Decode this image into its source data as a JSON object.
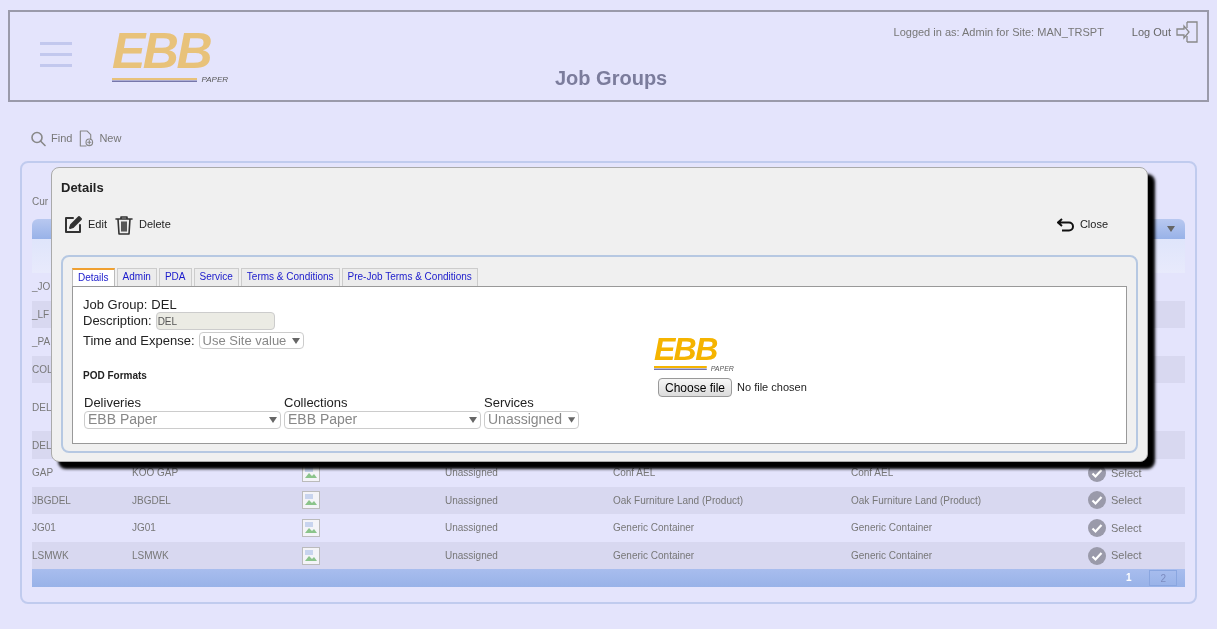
{
  "header": {
    "logo": {
      "name": "EBB",
      "tag": "PAPER"
    },
    "title": "Job Groups",
    "logged_in": "Logged in as: Admin for Site: MAN_TRSPT",
    "logout": "Log Out"
  },
  "toolbar": [
    {
      "kind": "find",
      "label": "Find"
    },
    {
      "kind": "new",
      "label": "New"
    }
  ],
  "list": {
    "label": "Cur",
    "rows": [
      {
        "cells": [
          "_JO"
        ]
      },
      {
        "cells": [
          "_LF"
        ]
      },
      {
        "cells": [
          "_PA"
        ]
      },
      {
        "cells": [
          "COL"
        ]
      },
      {
        "cells": [
          "DEL"
        ],
        "tall": true
      },
      {
        "cells": [
          "DEL"
        ]
      },
      {
        "cells": [
          "GAP",
          "KOO GAP",
          "Unassigned",
          "Conf AEL",
          "Conf AEL"
        ],
        "action": "Select"
      },
      {
        "cells": [
          "JBGDEL",
          "JBGDEL",
          "Unassigned",
          "Oak Furniture Land (Product)",
          "Oak Furniture Land (Product)"
        ],
        "action": "Select"
      },
      {
        "cells": [
          "JG01",
          "JG01",
          "Unassigned",
          "Generic Container",
          "Generic Container"
        ],
        "action": "Select"
      },
      {
        "cells": [
          "LSMWK",
          "LSMWK",
          "Unassigned",
          "Generic Container",
          "Generic Container"
        ],
        "action": "Select"
      }
    ],
    "pager": [
      {
        "label": "1",
        "selected": true
      },
      {
        "label": "2",
        "selected": false
      }
    ]
  },
  "modal": {
    "title": "Details",
    "actions": [
      {
        "kind": "edit",
        "label": "Edit"
      },
      {
        "kind": "delete",
        "label": "Delete"
      }
    ],
    "close": "Close",
    "tabs": [
      {
        "label": "Details",
        "selected": true
      },
      {
        "label": "Admin",
        "selected": false
      },
      {
        "label": "PDA",
        "selected": false
      },
      {
        "label": "Service",
        "selected": false
      },
      {
        "label": "Terms & Conditions",
        "selected": false
      },
      {
        "label": "Pre-Job Terms & Conditions",
        "selected": false
      }
    ],
    "job_group": {
      "label": "Job Group:",
      "value": "DEL"
    },
    "description": {
      "label": "Description:",
      "value": "DEL",
      "disabled": true
    },
    "time_expense": {
      "label": "Time and Expense:",
      "value": "Use Site value"
    },
    "section": "POD Formats",
    "pod_formats": [
      {
        "label": "Deliveries",
        "value": "EBB Paper"
      },
      {
        "label": "Collections",
        "value": "EBB Paper"
      },
      {
        "label": "Services",
        "value": "Unassigned"
      }
    ],
    "logo": {
      "name": "EBB",
      "tag": "PAPER"
    },
    "file": {
      "button": "Choose file",
      "status": "No file chosen"
    }
  }
}
